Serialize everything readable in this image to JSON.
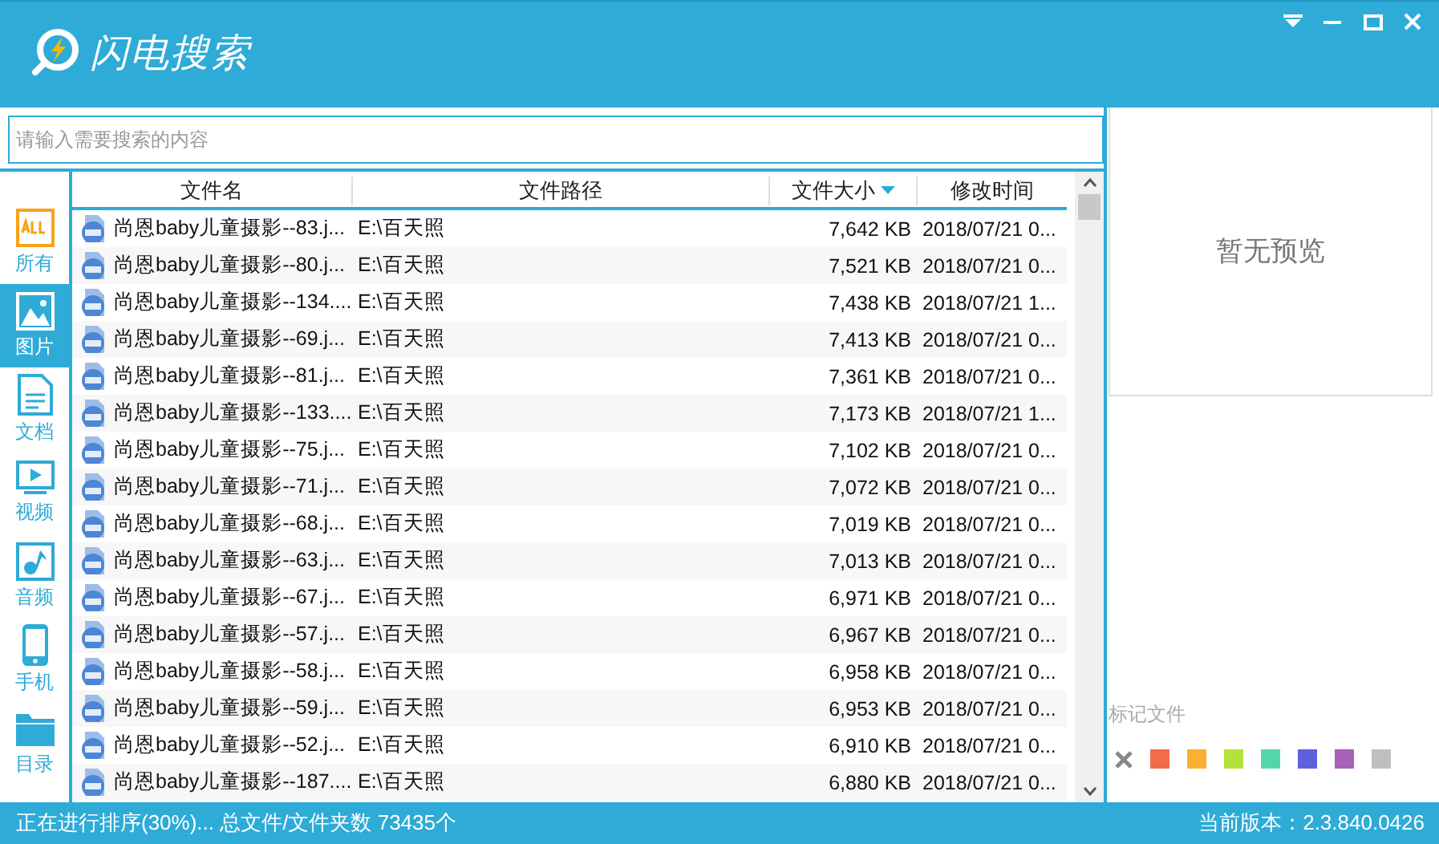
{
  "window": {
    "title": "闪电搜索"
  },
  "search": {
    "placeholder": "请输入需要搜索的内容"
  },
  "sidebar": {
    "items": [
      {
        "kind": "all",
        "label": "所有",
        "selected": false
      },
      {
        "kind": "image",
        "label": "图片",
        "selected": true
      },
      {
        "kind": "document",
        "label": "文档",
        "selected": false
      },
      {
        "kind": "video",
        "label": "视频",
        "selected": false
      },
      {
        "kind": "audio",
        "label": "音频",
        "selected": false
      },
      {
        "kind": "phone",
        "label": "手机",
        "selected": false
      },
      {
        "kind": "folder",
        "label": "目录",
        "selected": false
      }
    ]
  },
  "table": {
    "columns": [
      {
        "label": "文件名",
        "sorted": false
      },
      {
        "label": "文件路径",
        "sorted": false
      },
      {
        "label": "文件大小",
        "sorted": true
      },
      {
        "label": "修改时间",
        "sorted": false
      }
    ],
    "rows": [
      {
        "name": "尚恩baby儿童摄影--83.j...",
        "path": "E:\\百天照",
        "size": "7,642 KB",
        "time": "2018/07/21 0..."
      },
      {
        "name": "尚恩baby儿童摄影--80.j...",
        "path": "E:\\百天照",
        "size": "7,521 KB",
        "time": "2018/07/21 0..."
      },
      {
        "name": "尚恩baby儿童摄影--134....",
        "path": "E:\\百天照",
        "size": "7,438 KB",
        "time": "2018/07/21 1..."
      },
      {
        "name": "尚恩baby儿童摄影--69.j...",
        "path": "E:\\百天照",
        "size": "7,413 KB",
        "time": "2018/07/21 0..."
      },
      {
        "name": "尚恩baby儿童摄影--81.j...",
        "path": "E:\\百天照",
        "size": "7,361 KB",
        "time": "2018/07/21 0..."
      },
      {
        "name": "尚恩baby儿童摄影--133....",
        "path": "E:\\百天照",
        "size": "7,173 KB",
        "time": "2018/07/21 1..."
      },
      {
        "name": "尚恩baby儿童摄影--75.j...",
        "path": "E:\\百天照",
        "size": "7,102 KB",
        "time": "2018/07/21 0..."
      },
      {
        "name": "尚恩baby儿童摄影--71.j...",
        "path": "E:\\百天照",
        "size": "7,072 KB",
        "time": "2018/07/21 0..."
      },
      {
        "name": "尚恩baby儿童摄影--68.j...",
        "path": "E:\\百天照",
        "size": "7,019 KB",
        "time": "2018/07/21 0..."
      },
      {
        "name": "尚恩baby儿童摄影--63.j...",
        "path": "E:\\百天照",
        "size": "7,013 KB",
        "time": "2018/07/21 0..."
      },
      {
        "name": "尚恩baby儿童摄影--67.j...",
        "path": "E:\\百天照",
        "size": "6,971 KB",
        "time": "2018/07/21 0..."
      },
      {
        "name": "尚恩baby儿童摄影--57.j...",
        "path": "E:\\百天照",
        "size": "6,967 KB",
        "time": "2018/07/21 0..."
      },
      {
        "name": "尚恩baby儿童摄影--58.j...",
        "path": "E:\\百天照",
        "size": "6,958 KB",
        "time": "2018/07/21 0..."
      },
      {
        "name": "尚恩baby儿童摄影--59.j...",
        "path": "E:\\百天照",
        "size": "6,953 KB",
        "time": "2018/07/21 0..."
      },
      {
        "name": "尚恩baby儿童摄影--52.j...",
        "path": "E:\\百天照",
        "size": "6,910 KB",
        "time": "2018/07/21 0..."
      },
      {
        "name": "尚恩baby儿童摄影--187....",
        "path": "E:\\百天照",
        "size": "6,880 KB",
        "time": "2018/07/21 0..."
      }
    ]
  },
  "preview": {
    "message": "暂无预览"
  },
  "marks": {
    "title": "标记文件",
    "colors": [
      {
        "color": "#f26b4b"
      },
      {
        "color": "#f8b133"
      },
      {
        "color": "#b4e23c"
      },
      {
        "color": "#52d7ad"
      },
      {
        "color": "#6060dd"
      },
      {
        "color": "#a562b7"
      },
      {
        "color": "#bfbfbf"
      }
    ]
  },
  "status_bar": {
    "left": "正在进行排序(30%)... 总文件/文件夹数 73435个",
    "right": "当前版本：2.3.840.0426"
  }
}
